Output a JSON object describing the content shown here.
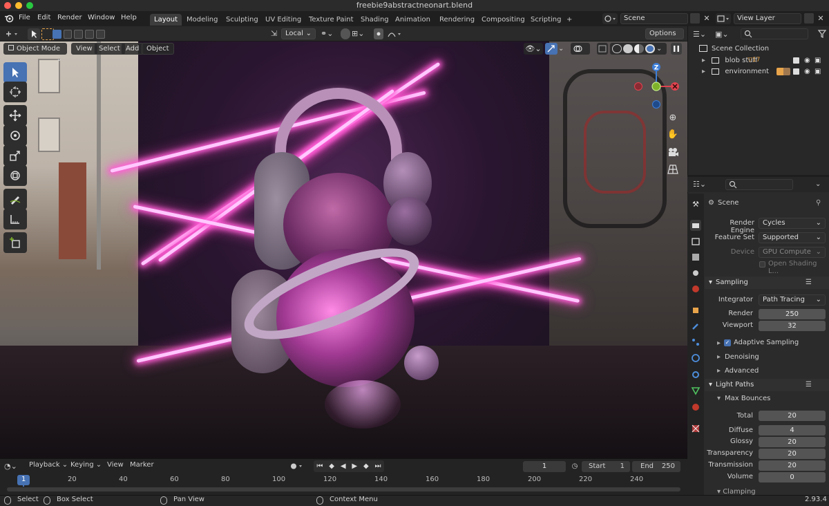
{
  "window": {
    "title": "freebie9abstractneonart.blend"
  },
  "menu": [
    "File",
    "Edit",
    "Render",
    "Window",
    "Help"
  ],
  "workspaces": [
    "Layout",
    "Modeling",
    "Sculpting",
    "UV Editing",
    "Texture Paint",
    "Shading",
    "Animation",
    "Rendering",
    "Compositing",
    "Scripting"
  ],
  "workspace_add": "+",
  "scene_field": "Scene",
  "view_layer_field": "View Layer",
  "header2": {
    "orientation": "Local",
    "options": "Options"
  },
  "viewport_header": {
    "mode": "Object Mode",
    "view": "View",
    "select": "Select",
    "add": "Add",
    "object": "Object"
  },
  "gizmo": {
    "z": "Z"
  },
  "outliner": {
    "collection": "Scene Collection",
    "items": [
      {
        "name": "blob stuff",
        "badge": "17"
      },
      {
        "name": "environment",
        "badge": ""
      }
    ]
  },
  "properties": {
    "scene_label": "Scene",
    "render_engine_label": "Render Engine",
    "render_engine": "Cycles",
    "feature_set_label": "Feature Set",
    "feature_set": "Supported",
    "device_label": "Device",
    "device": "GPU Compute",
    "open_shading": "Open Shading L...",
    "sampling": "Sampling",
    "integrator_label": "Integrator",
    "integrator": "Path Tracing",
    "render_label": "Render",
    "render": "250",
    "viewport_label": "Viewport",
    "viewport": "32",
    "adaptive_sampling": "Adaptive Sampling",
    "denoising": "Denoising",
    "advanced": "Advanced",
    "light_paths": "Light Paths",
    "max_bounces": "Max Bounces",
    "total_label": "Total",
    "total": "20",
    "diffuse_label": "Diffuse",
    "diffuse": "4",
    "glossy_label": "Glossy",
    "glossy": "20",
    "transparency_label": "Transparency",
    "transparency": "20",
    "transmission_label": "Transmission",
    "transmission": "20",
    "volume_label": "Volume",
    "volume": "0",
    "clamping": "Clamping"
  },
  "timeline": {
    "playback": "Playback",
    "keying": "Keying",
    "view": "View",
    "marker": "Marker",
    "current_frame": "1",
    "start_label": "Start",
    "start": "1",
    "end_label": "End",
    "end": "250",
    "ticks": [
      "1",
      "20",
      "40",
      "60",
      "80",
      "100",
      "120",
      "140",
      "160",
      "180",
      "200",
      "220",
      "240"
    ]
  },
  "status": {
    "select": "Select",
    "box_select": "Box Select",
    "pan_view": "Pan View",
    "context_menu": "Context Menu",
    "version": "2.93.4"
  },
  "colors": {
    "accent": "#4772b3",
    "neon": "#ff5fd6",
    "gizmo_x": "#e0434f",
    "gizmo_y": "#7fb32b",
    "gizmo_z": "#3d7ed8"
  }
}
